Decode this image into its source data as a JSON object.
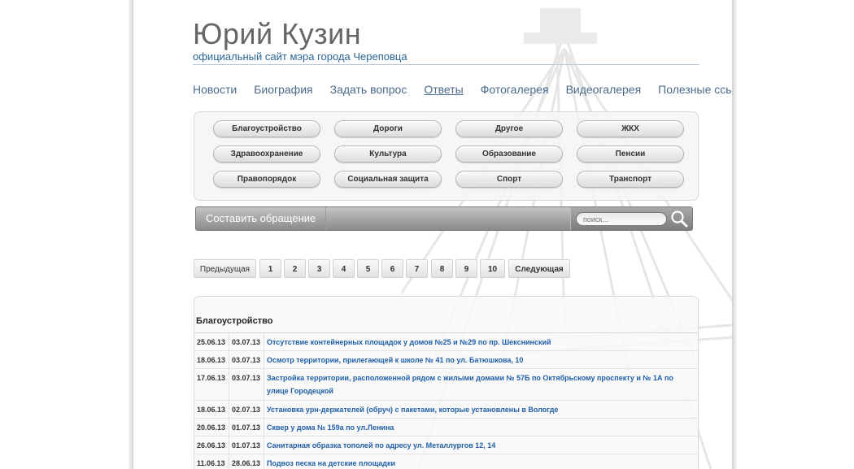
{
  "header": {
    "title": "Юрий Кузин",
    "subtitle": "официальный сайт мэра города Череповца"
  },
  "nav": [
    "Новости",
    "Биография",
    "Задать вопрос",
    "Ответы",
    "Фотогалерея",
    "Видеогалерея",
    "Полезные ссылки"
  ],
  "categories": [
    "Благоустройство",
    "Дороги",
    "Другое",
    "ЖКХ",
    "Здравоохранение",
    "Культура",
    "Образование",
    "Пенсии",
    "Правопорядок",
    "Социальная защита",
    "Спорт",
    "Транспорт"
  ],
  "toolbar": {
    "compose_label": "Составить обращение",
    "search_placeholder": "поиск..."
  },
  "pagination": {
    "prev": "Предыдущая",
    "pages": [
      "1",
      "2",
      "3",
      "4",
      "5",
      "6",
      "7",
      "8",
      "9",
      "10"
    ],
    "next": "Следующая"
  },
  "list": {
    "heading": "Благоустройство",
    "rows": [
      {
        "date1": "25.06.13",
        "date2": "03.07.13",
        "title": "Отсутствие контейнерных площадок у домов №25 и №29 по пр. Шекснинский"
      },
      {
        "date1": "18.06.13",
        "date2": "03.07.13",
        "title": "Осмотр территории, прилегающей к школе № 41 по ул. Батюшкова, 10"
      },
      {
        "date1": "17.06.13",
        "date2": "03.07.13",
        "title": "Застройка территории, расположенной рядом с жилыми домами № 57Б по Октябрьскому проспекту и № 1А по улице Городецкой"
      },
      {
        "date1": "18.06.13",
        "date2": "02.07.13",
        "title": "Установка урн-держателей (обруч) с пакетами, которые установлены в Вологде"
      },
      {
        "date1": "20.06.13",
        "date2": "01.07.13",
        "title": "Сквер у дома № 159а по ул.Ленина"
      },
      {
        "date1": "26.06.13",
        "date2": "01.07.13",
        "title": "Санитарная образка тополей по адресу ул. Металлургов 12, 14"
      },
      {
        "date1": "11.06.13",
        "date2": "28.06.13",
        "title": "Подвоз песка на детские площадки"
      }
    ]
  }
}
